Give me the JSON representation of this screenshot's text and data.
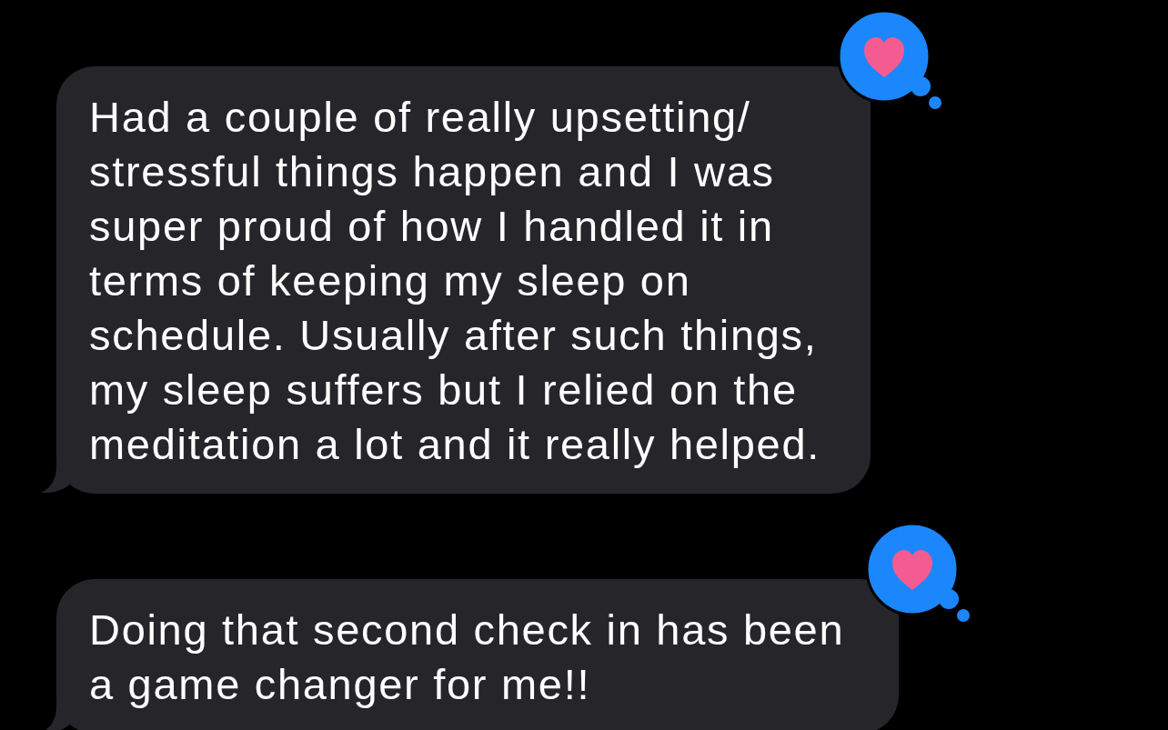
{
  "messages": [
    {
      "text": "Had a couple of really upsetting/ stressful things happen and I was super proud of how I handled it in terms of keeping my sleep on schedule. Usually after such things, my sleep suffers but I relied on the meditation a lot and it really helped.",
      "heart_reaction": true
    },
    {
      "text": "Doing that second check in has been a game changer for me!!",
      "heart_reaction": true
    }
  ]
}
